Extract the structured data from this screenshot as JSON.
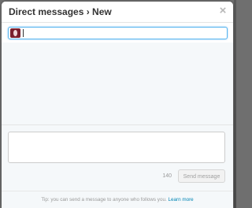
{
  "dialog": {
    "title": "Direct messages › New",
    "close_glyph": "×"
  },
  "recipient": {
    "value": "",
    "placeholder": ""
  },
  "compose": {
    "message_value": "",
    "char_count": "140",
    "send_label": "Send message"
  },
  "footer": {
    "tip": "Tip: you can send a message to anyone who follows you.",
    "learn_more": "Learn more"
  },
  "colors": {
    "accent_link": "#0084b4",
    "focus_border": "#56b4ef",
    "avatar": "#7a1f2e"
  },
  "icons": {
    "close": "close-icon",
    "avatar": "avatar"
  }
}
